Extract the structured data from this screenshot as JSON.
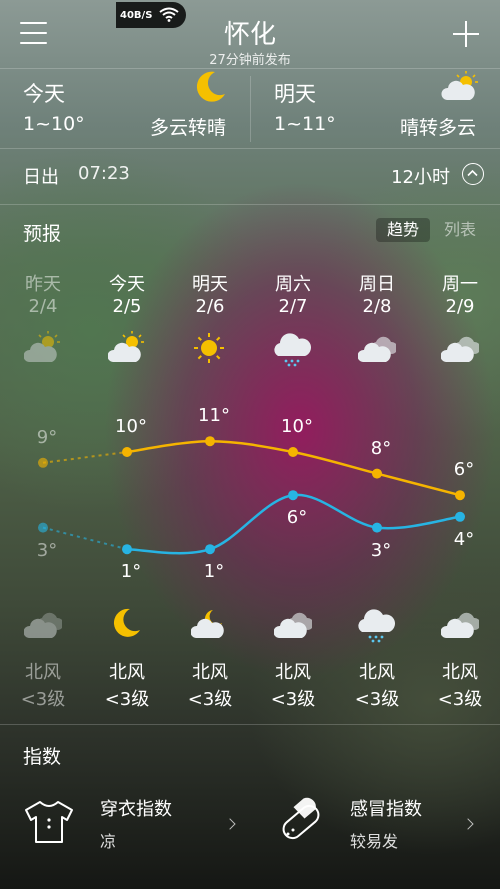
{
  "status_bar": {
    "speed": "40B/S",
    "wifi_icon": "wifi-icon"
  },
  "header": {
    "city": "怀化",
    "published": "27分钟前发布",
    "menu_icon": "menu-icon",
    "add_icon": "plus-icon"
  },
  "today": {
    "label": "今天",
    "range": "1~10°",
    "desc": "多云转晴",
    "icon": "moon-icon"
  },
  "tomorrow": {
    "label": "明天",
    "range": "1~11°",
    "desc": "晴转多云",
    "icon": "partly-cloudy-icon"
  },
  "sun": {
    "label": "日出",
    "time": "07:23",
    "hours": "12小时",
    "collapse_icon": "chevron-up-icon"
  },
  "forecast": {
    "title": "预报",
    "tab_trend": "趋势",
    "tab_list": "列表",
    "days": [
      {
        "name": "昨天",
        "date": "2/4",
        "day_icon": "partly-cloudy-icon",
        "high": "9°",
        "low": "3°",
        "night_icon": "cloudy-icon",
        "wind": "北风",
        "level": "<3级",
        "past": true
      },
      {
        "name": "今天",
        "date": "2/5",
        "day_icon": "partly-cloudy-icon",
        "high": "10°",
        "low": "1°",
        "night_icon": "moon-icon",
        "wind": "北风",
        "level": "<3级",
        "past": false
      },
      {
        "name": "明天",
        "date": "2/6",
        "day_icon": "sun-icon",
        "high": "11°",
        "low": "1°",
        "night_icon": "cloudy-moon-icon",
        "wind": "北风",
        "level": "<3级",
        "past": false
      },
      {
        "name": "周六",
        "date": "2/7",
        "day_icon": "rain-icon",
        "high": "10°",
        "low": "6°",
        "night_icon": "cloudy-icon",
        "wind": "北风",
        "level": "<3级",
        "past": false
      },
      {
        "name": "周日",
        "date": "2/8",
        "day_icon": "cloudy-icon",
        "high": "8°",
        "low": "3°",
        "night_icon": "rain-icon",
        "wind": "北风",
        "level": "<3级",
        "past": false
      },
      {
        "name": "周一",
        "date": "2/9",
        "day_icon": "cloudy-icon",
        "high": "6°",
        "low": "4°",
        "night_icon": "cloudy-icon",
        "wind": "北风",
        "level": "<3级",
        "past": false
      }
    ]
  },
  "chart_data": {
    "type": "line",
    "categories": [
      "2/4",
      "2/5",
      "2/6",
      "2/7",
      "2/8",
      "2/9"
    ],
    "series": [
      {
        "values": [
          9,
          10,
          11,
          10,
          8,
          6
        ],
        "color": "#f5b400"
      },
      {
        "values": [
          3,
          1,
          1,
          6,
          3,
          4
        ],
        "color": "#27b4e3"
      }
    ]
  },
  "indices": {
    "title": "指数",
    "items": [
      {
        "name": "穿衣指数",
        "value": "凉",
        "icon": "tshirt-icon"
      },
      {
        "name": "感冒指数",
        "value": "较易发",
        "icon": "pill-icon"
      }
    ]
  }
}
